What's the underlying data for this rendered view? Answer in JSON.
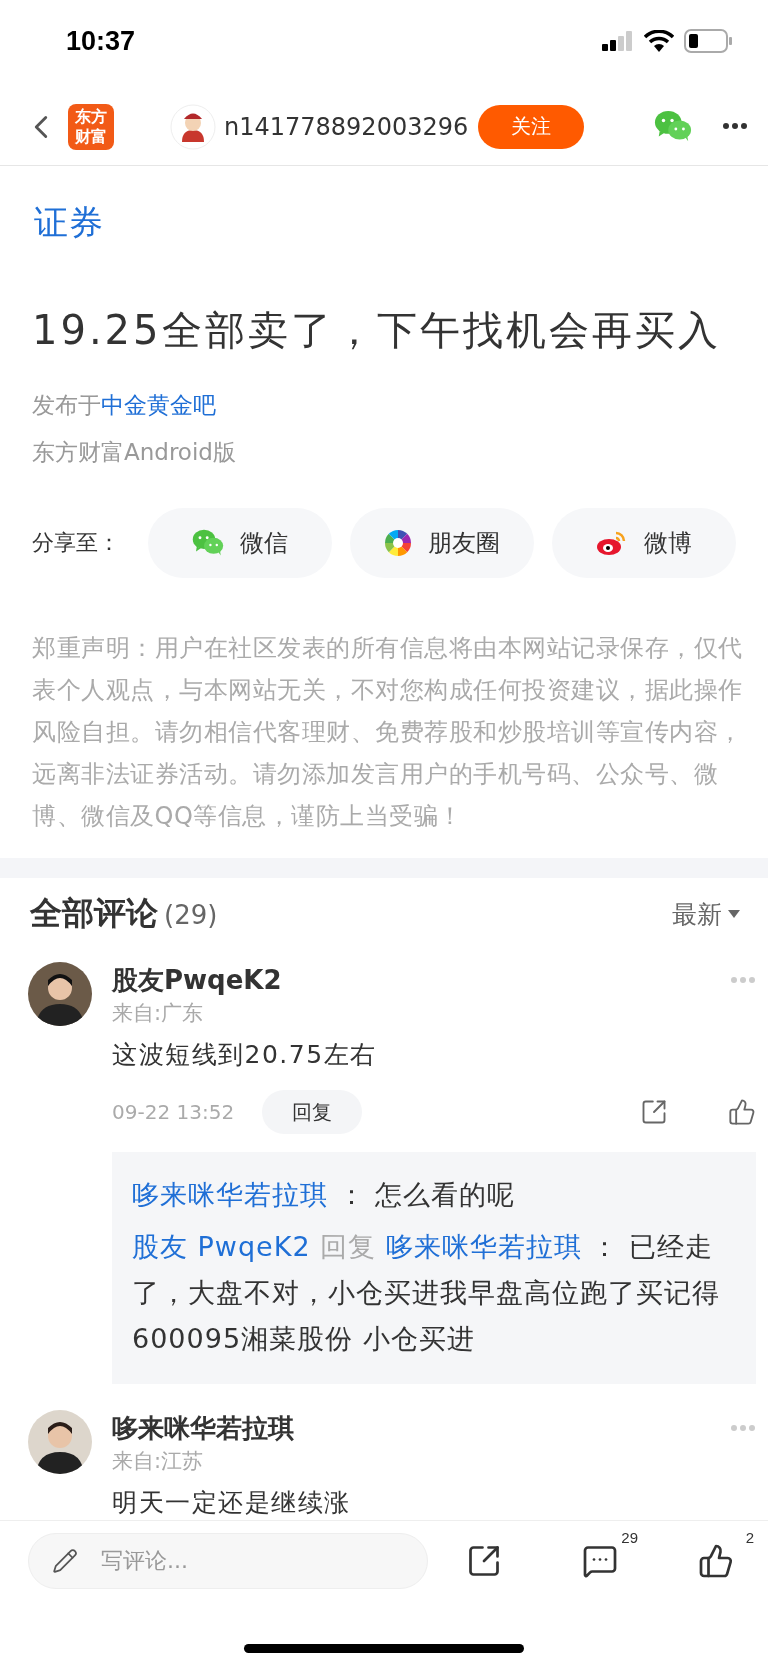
{
  "status_bar": {
    "time": "10:37"
  },
  "header": {
    "app_logo": "东方财富",
    "user_name": "n141778892003296",
    "follow_button": "关注"
  },
  "post": {
    "promo_link": "证券",
    "title": "19.25全部卖了，下午找机会再买入",
    "published_prefix": "发布于",
    "forum": "中金黄金吧",
    "source": "东方财富Android版"
  },
  "share": {
    "label": "分享至：",
    "targets": [
      {
        "kind": "wechat",
        "label": "微信"
      },
      {
        "kind": "moments",
        "label": "朋友圈"
      },
      {
        "kind": "weibo",
        "label": "微博"
      }
    ]
  },
  "disclaimer": "郑重声明：用户在社区发表的所有信息将由本网站记录保存，仅代表个人观点，与本网站无关，不对您构成任何投资建议，据此操作风险自担。请勿相信代客理财、免费荐股和炒股培训等宣传内容，远离非法证券活动。请勿添加发言用户的手机号码、公众号、微博、微信及QQ等信息，谨防上当受骗！",
  "comments_section": {
    "title": "全部评论",
    "count": "(29)",
    "sort": "最新"
  },
  "comments": [
    {
      "name": "股友PwqeK2",
      "location": "来自:广东",
      "text": "这波短线到20.75左右",
      "time": "09-22 13:52",
      "reply_button": "回复",
      "replies": [
        {
          "author": "哆来咪华若拉琪",
          "separator": "：",
          "text": "怎么看的呢"
        },
        {
          "author": "股友 PwqeK2",
          "reply_word": "回复",
          "target": "哆来咪华若拉琪",
          "separator": "：",
          "text": "已经走了，大盘不对，小仓买进我早盘高位跑了买记得600095湘菜股份 小仓买进"
        }
      ]
    },
    {
      "name": "哆来咪华若拉琪",
      "location": "来自:江苏",
      "text": "明天一定还是继续涨"
    }
  ],
  "bottom_bar": {
    "placeholder": "写评论...",
    "comment_count": "29",
    "like_count": "2"
  }
}
